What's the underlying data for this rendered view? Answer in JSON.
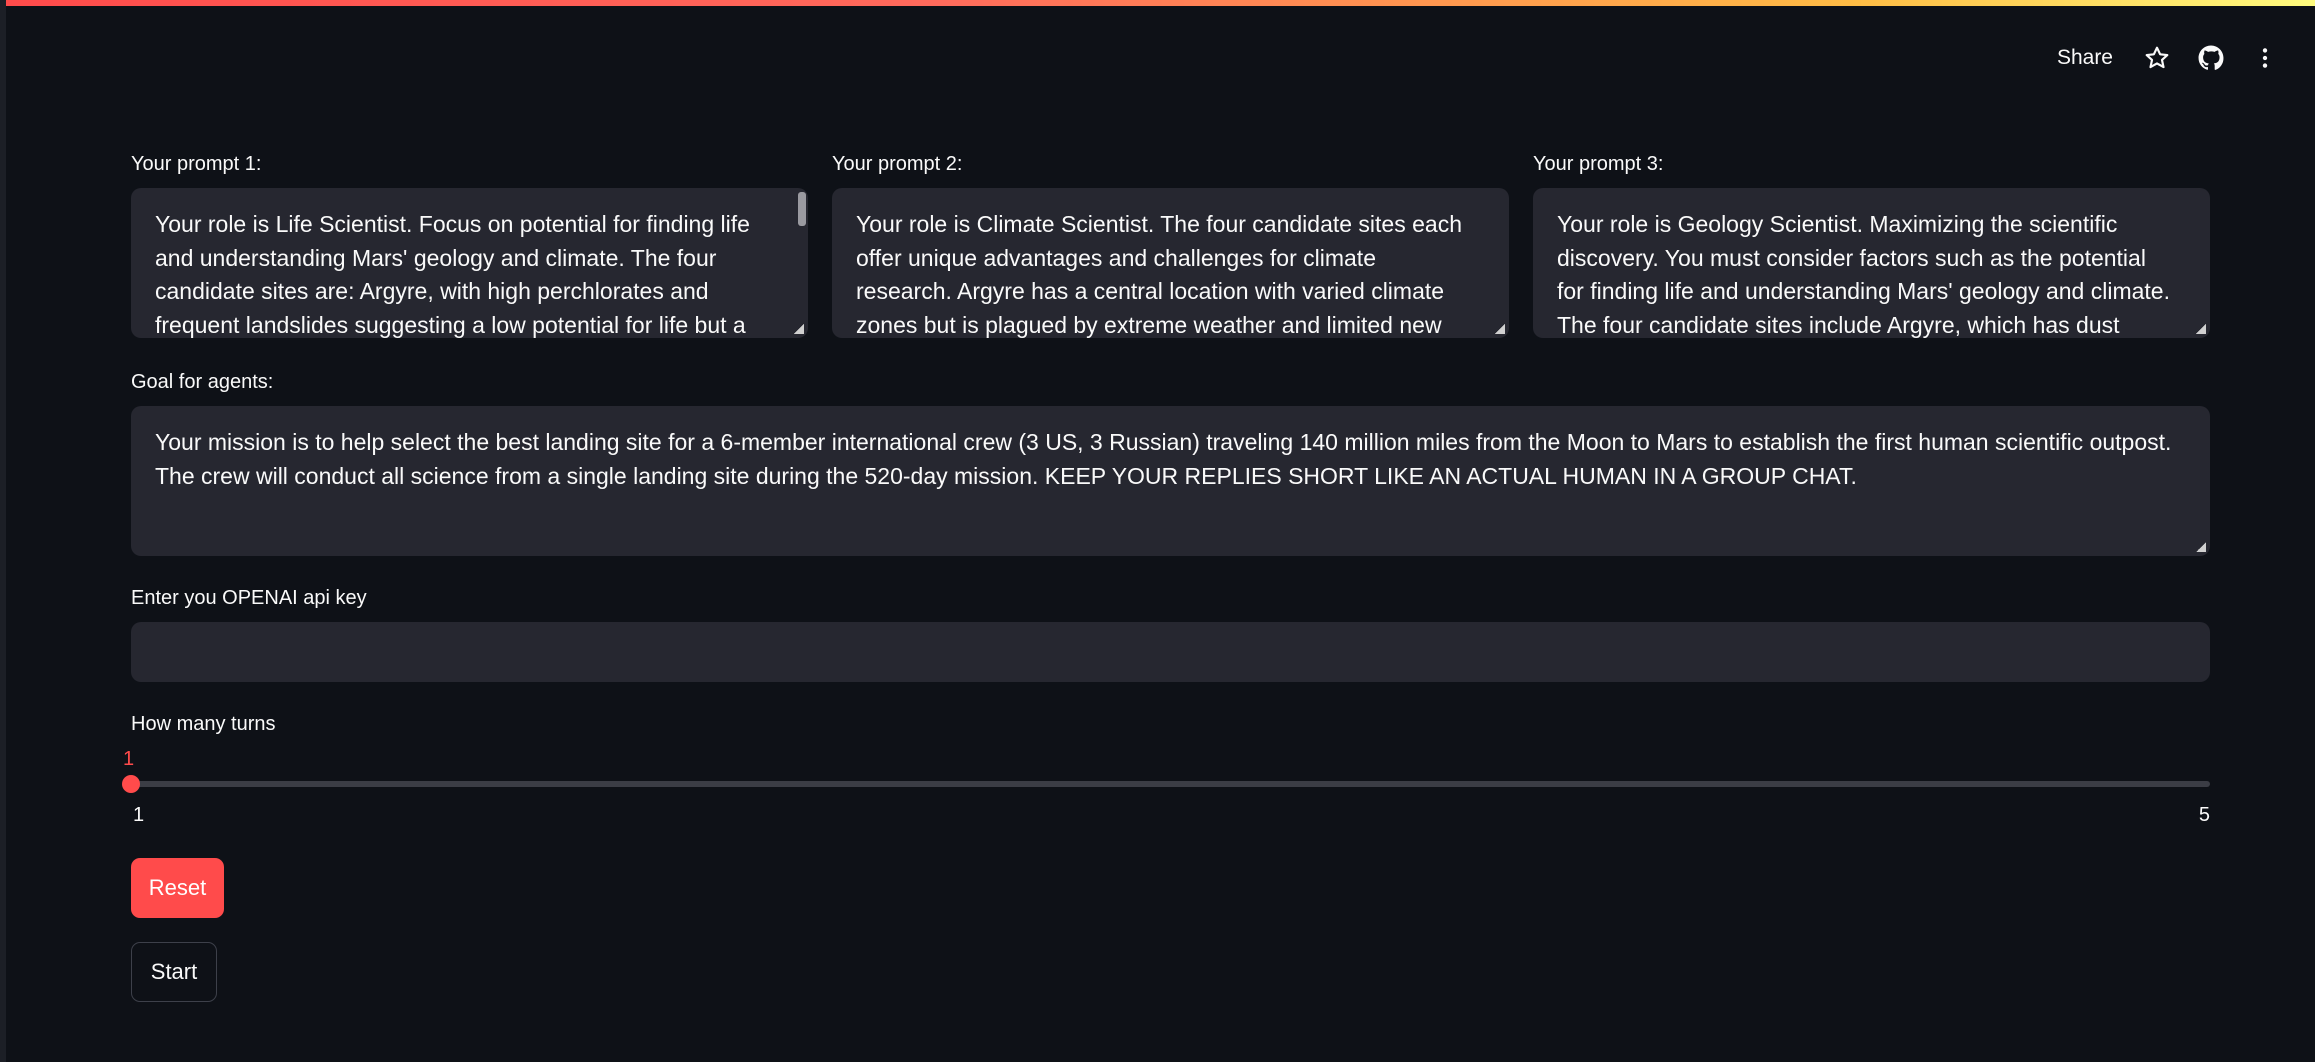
{
  "header": {
    "share_label": "Share",
    "icons": [
      "star-icon",
      "github-icon",
      "more-vertical-icon"
    ]
  },
  "prompts": [
    {
      "label": "Your prompt 1:",
      "value": "Your role is Life Scientist. Focus on potential for finding life and understanding Mars' geology and climate. The four candidate sites are: Argyre, with high perchlorates and frequent landslides suggesting a low potential for life but a"
    },
    {
      "label": "Your prompt 2:",
      "value": "Your role is Climate Scientist. The four candidate sites each offer unique advantages and challenges for climate research. Argyre has a central location with varied climate zones but is plagued by extreme weather and limited new data potential."
    },
    {
      "label": "Your prompt 3:",
      "value": "Your role is Geology Scientist. Maximizing the scientific discovery. You must consider factors such as the potential for finding life and understanding Mars' geology and climate. The four candidate sites include Argyre, which has dust devils,"
    }
  ],
  "goal": {
    "label": "Goal for agents:",
    "value": "Your mission is to help select the best landing site for a 6-member international crew (3 US, 3 Russian) traveling 140 million miles from the Moon to Mars to establish the first human scientific outpost. The crew will conduct all science from a single landing site during the 520-day mission. KEEP YOUR REPLIES SHORT LIKE AN ACTUAL HUMAN IN A GROUP CHAT."
  },
  "api_key": {
    "label": "Enter you OPENAI api key",
    "value": ""
  },
  "turns": {
    "label": "How many turns",
    "value": "1",
    "min": "1",
    "max": "5",
    "accent": "#ff4b4b"
  },
  "buttons": {
    "reset_label": "Reset",
    "start_label": "Start"
  }
}
